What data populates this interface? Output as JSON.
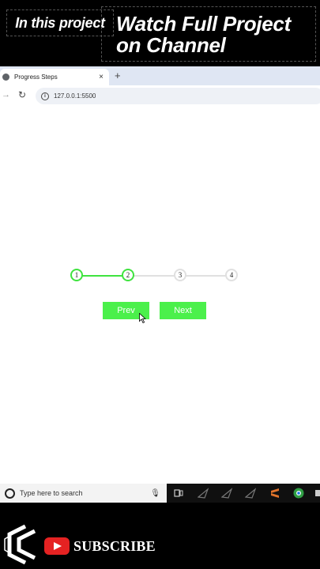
{
  "overlay": {
    "left_tag": "In this project",
    "right_tag_line1": "Watch Full Project",
    "right_tag_line2": "on Channel"
  },
  "browser": {
    "tab_title": "Progress Steps",
    "tab_close": "×",
    "new_tab": "+",
    "forward_icon": "→",
    "reload_icon": "↻",
    "url": "127.0.0.1:5500"
  },
  "progress": {
    "steps": [
      "1",
      "2",
      "3",
      "4"
    ],
    "active_steps": 2,
    "active_color": "#3fe33f",
    "inactive_color": "#e0e0e0"
  },
  "buttons": {
    "prev_label": "Prev",
    "next_label": "Next",
    "color": "#4bf04b"
  },
  "taskbar": {
    "search_placeholder": "Type here to search"
  },
  "branding": {
    "subscribe_label": "SUBSCRIBE",
    "youtube_color": "#e52222"
  }
}
